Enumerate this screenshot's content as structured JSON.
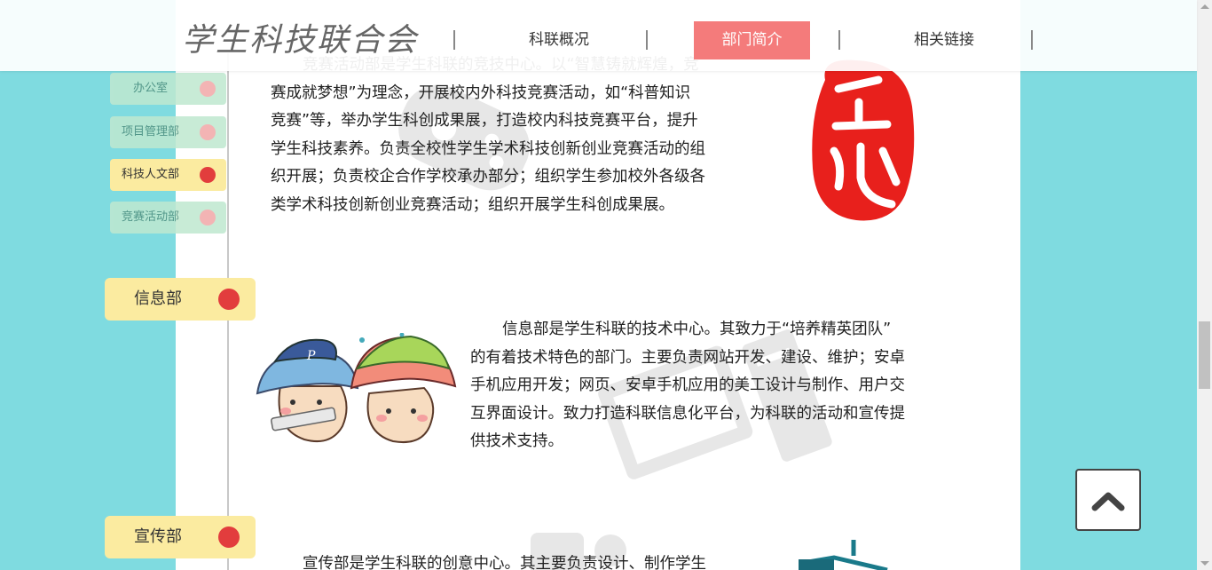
{
  "header": {
    "logo_text": "学生科技联合会",
    "nav": [
      {
        "label": "科联概况"
      },
      {
        "label": "部门简介"
      },
      {
        "label": "相关链接"
      }
    ]
  },
  "sidebar": {
    "items": [
      {
        "label": "办公室"
      },
      {
        "label": "项目管理部"
      },
      {
        "label": "科技人文部"
      },
      {
        "label": "竞赛活动部"
      }
    ]
  },
  "sections": {
    "competition": {
      "paragraph_lines": [
        "竞赛活动部是学生科联的竞技中心。以“智慧铸就辉煌，竞",
        "赛成就梦想”为理念，开展校内外科技竞赛活动，如“科普知识",
        "竞赛”等，举办学生科创成果展，打造校内科技竞赛平台，提升",
        "学生科技素养。负责全校性学生学术科技创新创业竞赛活动的组",
        "织开展；负责校企合作学校承办部分；组织学生参加校外各级各",
        "类学术科技创新创业竞赛活动；组织开展学生科创成果展。"
      ]
    },
    "info": {
      "title": "信息部",
      "paragraph_lines": [
        "信息部是学生科联的技术中心。其致力于“培养精英团队”",
        "的有着技术特色的部门。主要负责网站开发、建设、维护；安卓",
        "手机应用开发；网页、安卓手机应用的美工设计与制作、用户交",
        "互界面设计。致力打造科联信息化平台，为科联的活动和宣传提",
        "供技术支持。"
      ]
    },
    "publicity": {
      "title": "宣传部",
      "paragraph_lines": [
        "宣传部是学生科联的创意中心。其主要负责设计、制作学生"
      ]
    }
  },
  "colors": {
    "background": "#7fdbe0",
    "nav_active": "#f47b7b",
    "tab_yellow": "#fbeba0",
    "dot_red": "#e23d3d"
  },
  "icons": {
    "back_to_top": "chevron-up-icon",
    "seal": "red-seal-icon",
    "mascots": "mushroom-mascots-illustration"
  }
}
